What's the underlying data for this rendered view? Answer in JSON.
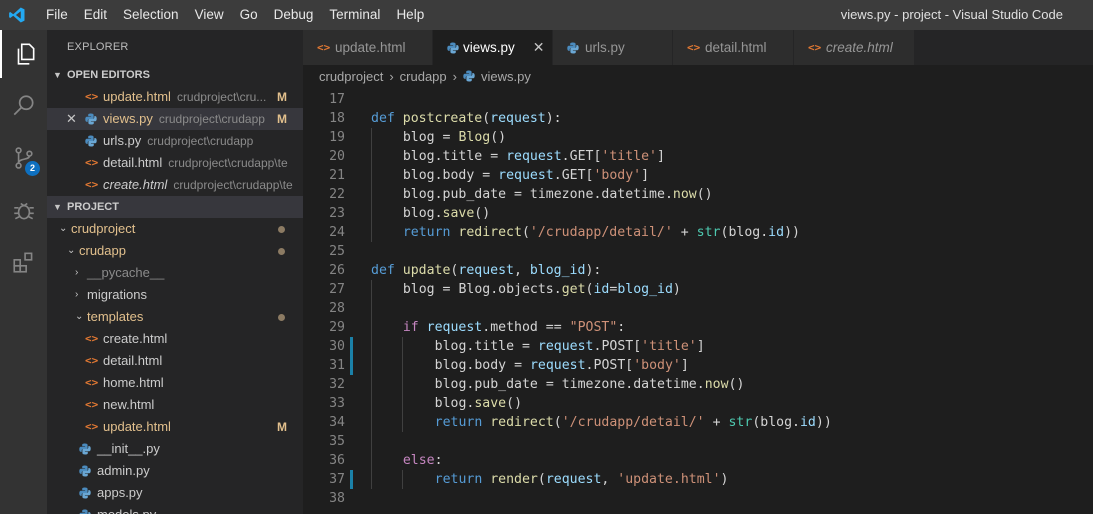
{
  "titlebar": {
    "menu": [
      "File",
      "Edit",
      "Selection",
      "View",
      "Go",
      "Debug",
      "Terminal",
      "Help"
    ],
    "window_title": "views.py - project - Visual Studio Code"
  },
  "activity_bar": {
    "items": [
      "files-icon",
      "search-icon",
      "source-control-icon",
      "debug-icon",
      "extensions-icon"
    ],
    "scm_badge": "2"
  },
  "explorer": {
    "title": "EXPLORER",
    "open_editors_label": "OPEN EDITORS",
    "open_editors": [
      {
        "name": "update.html",
        "path": "crudproject\\cru...",
        "badge": "M",
        "type": "html"
      },
      {
        "name": "views.py",
        "path": "crudproject\\crudapp",
        "badge": "M",
        "type": "py"
      },
      {
        "name": "urls.py",
        "path": "crudproject\\crudapp",
        "badge": "",
        "type": "py"
      },
      {
        "name": "detail.html",
        "path": "crudproject\\crudapp\\te...",
        "badge": "",
        "type": "html"
      },
      {
        "name": "create.html",
        "path": "crudproject\\crudapp\\te...",
        "badge": "",
        "type": "html"
      }
    ],
    "project_label": "PROJECT",
    "tree": [
      {
        "name": "crudproject",
        "kind": "folder-open",
        "depth": 0
      },
      {
        "name": "crudapp",
        "kind": "folder-open",
        "depth": 1
      },
      {
        "name": "__pycache__",
        "kind": "folder",
        "depth": 2
      },
      {
        "name": "migrations",
        "kind": "folder",
        "depth": 2
      },
      {
        "name": "templates",
        "kind": "folder-open",
        "depth": 2
      },
      {
        "name": "create.html",
        "kind": "html",
        "depth": 3
      },
      {
        "name": "detail.html",
        "kind": "html",
        "depth": 3
      },
      {
        "name": "home.html",
        "kind": "html",
        "depth": 3
      },
      {
        "name": "new.html",
        "kind": "html",
        "depth": 3
      },
      {
        "name": "update.html",
        "kind": "html",
        "depth": 3
      },
      {
        "name": "__init__.py",
        "kind": "py",
        "depth": 2
      },
      {
        "name": "admin.py",
        "kind": "py",
        "depth": 2
      },
      {
        "name": "apps.py",
        "kind": "py",
        "depth": 2
      },
      {
        "name": "models.py",
        "kind": "py",
        "depth": 2
      }
    ],
    "modified_badge": "M"
  },
  "tabs": [
    {
      "label": "update.html",
      "type": "html"
    },
    {
      "label": "views.py",
      "type": "py"
    },
    {
      "label": "urls.py",
      "type": "py"
    },
    {
      "label": "detail.html",
      "type": "html"
    },
    {
      "label": "create.html",
      "type": "html"
    }
  ],
  "breadcrumb": [
    "crudproject",
    "crudapp",
    "views.py"
  ],
  "editor": {
    "lines": [
      {
        "n": "17",
        "code": ""
      },
      {
        "n": "18",
        "code": "def postcreate(request):"
      },
      {
        "n": "19",
        "code": "    blog = Blog()"
      },
      {
        "n": "20",
        "code": "    blog.title = request.GET['title']"
      },
      {
        "n": "21",
        "code": "    blog.body = request.GET['body']"
      },
      {
        "n": "22",
        "code": "    blog.pub_date = timezone.datetime.now()"
      },
      {
        "n": "23",
        "code": "    blog.save()"
      },
      {
        "n": "24",
        "code": "    return redirect('/crudapp/detail/' + str(blog.id))"
      },
      {
        "n": "25",
        "code": ""
      },
      {
        "n": "26",
        "code": "def update(request, blog_id):"
      },
      {
        "n": "27",
        "code": "    blog = Blog.objects.get(id=blog_id)"
      },
      {
        "n": "28",
        "code": ""
      },
      {
        "n": "29",
        "code": "    if request.method == \"POST\":"
      },
      {
        "n": "30",
        "code": "        blog.title = request.POST['title']"
      },
      {
        "n": "31",
        "code": "        blog.body = request.POST['body']"
      },
      {
        "n": "32",
        "code": "        blog.pub_date = timezone.datetime.now()"
      },
      {
        "n": "33",
        "code": "        blog.save()"
      },
      {
        "n": "34",
        "code": "        return redirect('/crudapp/detail/' + str(blog.id))"
      },
      {
        "n": "35",
        "code": ""
      },
      {
        "n": "36",
        "code": "    else:"
      },
      {
        "n": "37",
        "code": "        return render(request, 'update.html')"
      },
      {
        "n": "38",
        "code": ""
      }
    ],
    "modified_lines": [
      "30",
      "31",
      "37"
    ]
  },
  "colors": {
    "titlebar": "#3c3c3c",
    "activity_bar": "#333333",
    "sidebar": "#252526",
    "editor": "#1e1e1e",
    "badge_blue": "#0e70c0",
    "modified": "#e2c08d"
  }
}
